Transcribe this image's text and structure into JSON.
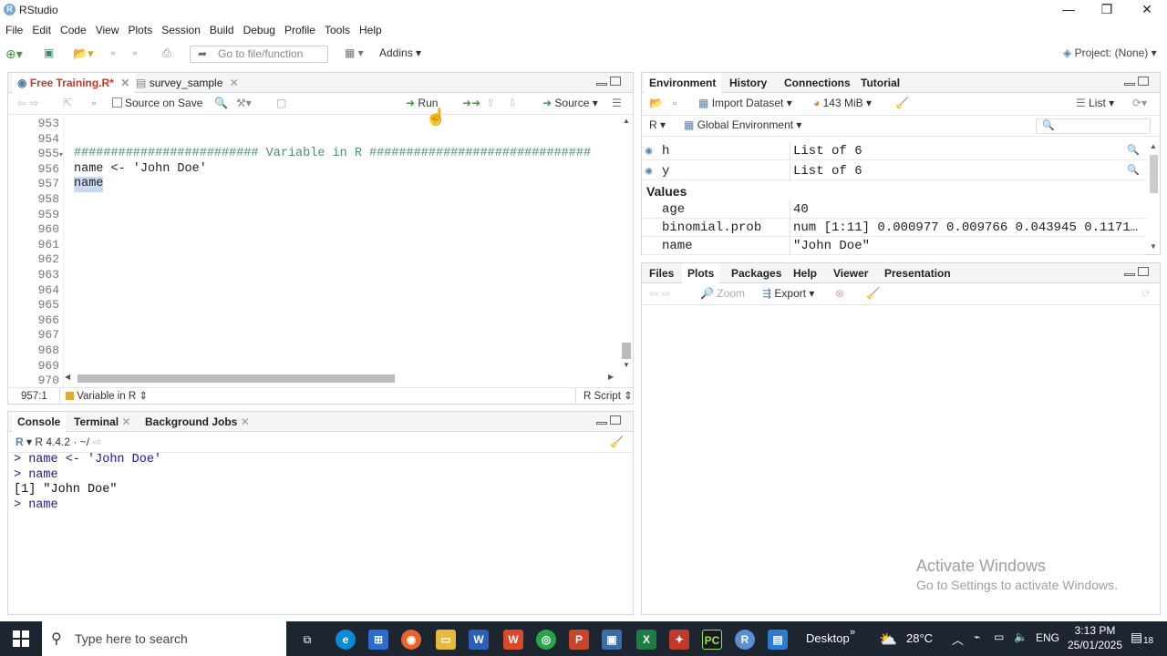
{
  "window": {
    "title": "RStudio"
  },
  "menu": [
    "File",
    "Edit",
    "Code",
    "View",
    "Plots",
    "Session",
    "Build",
    "Debug",
    "Profile",
    "Tools",
    "Help"
  ],
  "toolbar": {
    "goto_placeholder": "Go to file/function",
    "addins": "Addins",
    "project": "Project: (None)"
  },
  "editor": {
    "tabs": [
      {
        "label": "Free Training.R*"
      },
      {
        "label": "survey_sample"
      }
    ],
    "source_on_save": "Source on Save",
    "run": "Run",
    "source": "Source",
    "lines": [
      {
        "n": "953",
        "code": ""
      },
      {
        "n": "954",
        "code": ""
      },
      {
        "n": "955",
        "code": "######################### Variable in R ##############################"
      },
      {
        "n": "956",
        "code": "name <- 'John Doe'"
      },
      {
        "n": "957",
        "code": "name"
      },
      {
        "n": "958",
        "code": ""
      },
      {
        "n": "959",
        "code": ""
      },
      {
        "n": "960",
        "code": ""
      },
      {
        "n": "961",
        "code": ""
      },
      {
        "n": "962",
        "code": ""
      },
      {
        "n": "963",
        "code": ""
      },
      {
        "n": "964",
        "code": ""
      },
      {
        "n": "965",
        "code": ""
      },
      {
        "n": "966",
        "code": ""
      },
      {
        "n": "967",
        "code": ""
      },
      {
        "n": "968",
        "code": ""
      },
      {
        "n": "969",
        "code": ""
      },
      {
        "n": "970",
        "code": ""
      }
    ],
    "status": {
      "position": "957:1",
      "section": "Variable in R",
      "type": "R Script"
    }
  },
  "console": {
    "tabs": [
      {
        "label": "Console"
      },
      {
        "label": "Terminal"
      },
      {
        "label": "Background Jobs"
      }
    ],
    "version": "R 4.4.2 · ~/",
    "lines": [
      "> name <- 'John Doe'",
      "> name",
      "[1] \"John Doe\"",
      "> name"
    ]
  },
  "environment": {
    "tabs": [
      {
        "label": "Environment"
      },
      {
        "label": "History"
      },
      {
        "label": "Connections"
      },
      {
        "label": "Tutorial"
      }
    ],
    "import_dataset": "Import Dataset",
    "memory": "143 MiB",
    "view_mode": "List",
    "lang": "R",
    "scope": "Global Environment",
    "data_rows": [
      {
        "name": "h",
        "value": "List of  6"
      },
      {
        "name": "y",
        "value": "List of  6"
      }
    ],
    "values_header": "Values",
    "value_rows": [
      {
        "name": "age",
        "value": "40"
      },
      {
        "name": "binomial.prob",
        "value": "num [1:11] 0.000977 0.009766 0.043945 0.1171…"
      },
      {
        "name": "name",
        "value": "\"John Doe\""
      }
    ]
  },
  "files": {
    "tabs": [
      {
        "label": "Files"
      },
      {
        "label": "Plots"
      },
      {
        "label": "Packages"
      },
      {
        "label": "Help"
      },
      {
        "label": "Viewer"
      },
      {
        "label": "Presentation"
      }
    ],
    "zoom": "Zoom",
    "export": "Export"
  },
  "watermark": {
    "line1": "Activate Windows",
    "line2": "Go to Settings to activate Windows."
  },
  "taskbar": {
    "search": "Type here to search",
    "desktop": "Desktop",
    "weather": "28°C",
    "lang": "ENG",
    "time": "3:13 PM",
    "date": "25/01/2025",
    "notifications": "18"
  }
}
